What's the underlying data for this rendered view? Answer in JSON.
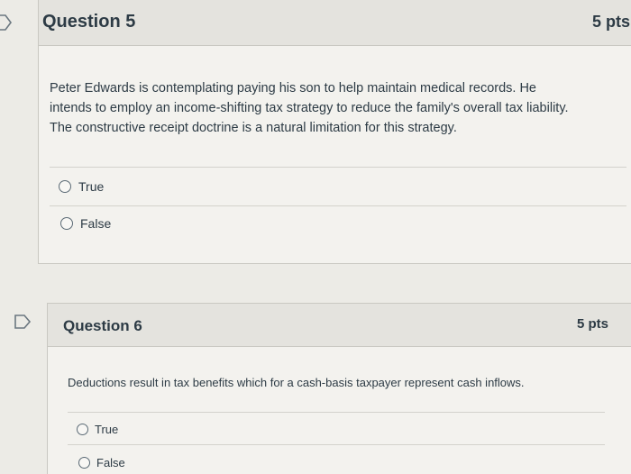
{
  "questions": [
    {
      "title": "Question 5",
      "points": "5 pts",
      "text_lines": [
        "Peter Edwards is contemplating paying his son to help maintain medical records. He",
        "intends to employ an income-shifting tax strategy to reduce the family's overall tax liability.",
        "The constructive receipt doctrine is a natural limitation for this strategy."
      ],
      "answers": [
        "True",
        "False"
      ]
    },
    {
      "title": "Question 6",
      "points": "5 pts",
      "text_lines": [
        "Deductions result in tax benefits which for a cash-basis taxpayer represent cash inflows."
      ],
      "answers": [
        "True",
        "False"
      ]
    }
  ],
  "icons": {
    "q5_flag": "bookmark-flag-icon",
    "q6_flag": "bookmark-flag-icon"
  },
  "colors": {
    "background": "#ecebe6",
    "header": "#e4e3de",
    "text": "#2d3b45"
  }
}
